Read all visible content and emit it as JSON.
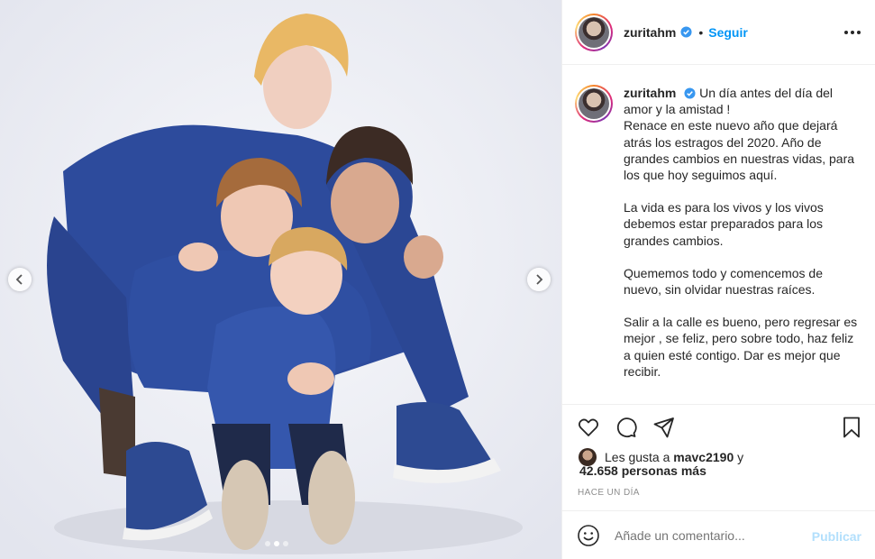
{
  "post": {
    "username": "zuritahm",
    "follow_label": "Seguir",
    "separator": "•"
  },
  "caption": {
    "username": "zuritahm",
    "paragraphs": [
      "Un día antes del día del amor y la amistad !",
      "Renace en este nuevo año que dejará atrás los estragos del 2020. Año de grandes cambios en nuestras vidas, para los que hoy seguimos aquí.",
      "La vida es para los vivos y los vivos debemos estar preparados para los grandes cambios.",
      "Quememos todo y comencemos de nuevo, sin olvidar nuestras raíces.",
      "Salir a la calle es bueno, pero regresar es mejor , se feliz, pero sobre todo, haz feliz a quien esté contigo. Dar es mejor que recibir."
    ]
  },
  "likes": {
    "prefix": "Les gusta a",
    "user": "mavc2190",
    "joiner": "y",
    "count_text": "42.658 personas más"
  },
  "timestamp": "HACE UN DÍA",
  "comment": {
    "placeholder": "Añade un comentario...",
    "publish_label": "Publicar"
  },
  "carousel": {
    "total": 3,
    "active": 1
  },
  "colors": {
    "accent": "#0095f6",
    "publish_disabled": "#b2dffc",
    "outfit": "#2f4ea0"
  },
  "icons": [
    "chevron-left-icon",
    "chevron-right-icon",
    "verified-badge-icon",
    "more-icon",
    "heart-icon",
    "comment-icon",
    "share-icon",
    "bookmark-icon",
    "emoji-icon"
  ]
}
